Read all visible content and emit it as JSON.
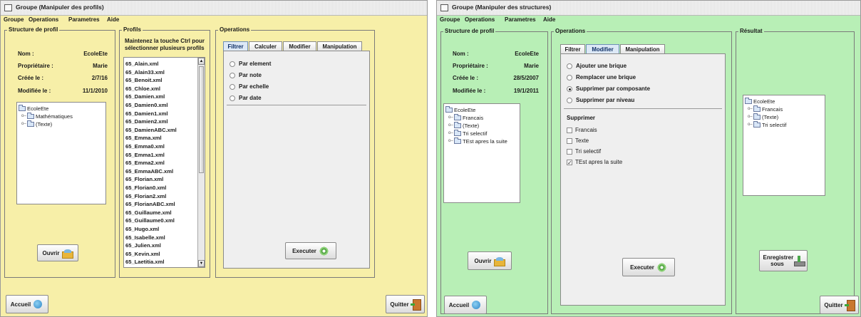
{
  "window1": {
    "title": "Groupe (Manipuler des profils)",
    "menu": [
      "Groupe",
      "Operations",
      "Parametres",
      "Aide"
    ],
    "structure_panel": {
      "legend": "Structure de profil",
      "fields": [
        {
          "label": "Nom :",
          "value": "EcoleEte"
        },
        {
          "label": "Propriétaire :",
          "value": "Marie"
        },
        {
          "label": "Créée le :",
          "value": "2/7/16"
        },
        {
          "label": "Modifiée le :",
          "value": "11/1/2010"
        }
      ],
      "tree": {
        "root": "EcoleEte",
        "children": [
          "Mathématiques",
          "(Texte)"
        ]
      },
      "open_button": "Ouvrir"
    },
    "profils_panel": {
      "legend": "Profils",
      "hint": [
        "Maintenez la touche Ctrl pour",
        "sélectionner plusieurs profils"
      ],
      "files": [
        "65_Alain.xml",
        "65_Alain33.xml",
        "65_Benoit.xml",
        "65_Chloe.xml",
        "65_Damien.xml",
        "65_Damien0.xml",
        "65_Damien1.xml",
        "65_Damien2.xml",
        "65_DamienABC.xml",
        "65_Emma.xml",
        "65_Emma0.xml",
        "65_Emma1.xml",
        "65_Emma2.xml",
        "65_EmmaABC.xml",
        "65_Florian.xml",
        "65_Florian0.xml",
        "65_Florian2.xml",
        "65_FlorianABC.xml",
        "65_Guillaume.xml",
        "65_Guillaume0.xml",
        "65_Hugo.xml",
        "65_Isabelle.xml",
        "65_Julien.xml",
        "65_Kevin.xml",
        "65_Laetitia.xml"
      ]
    },
    "operations_panel": {
      "legend": "Operations",
      "tabs": [
        "Filtrer",
        "Calculer",
        "Modifier",
        "Manipulation"
      ],
      "active_tab": "Filtrer",
      "radios": [
        "Par element",
        "Par note",
        "Par echelle",
        "Par date"
      ],
      "execute_button": "Executer"
    },
    "home_button": "Accueil",
    "quit_button": "Quitter"
  },
  "window2": {
    "title": "Groupe (Manipuler des structures)",
    "menu": [
      "Groupe",
      "Operations",
      "Parametres",
      "Aide"
    ],
    "structure_panel": {
      "legend": "Structure de profil",
      "fields": [
        {
          "label": "Nom :",
          "value": "EcoleEte"
        },
        {
          "label": "Propriétaire :",
          "value": "Marie"
        },
        {
          "label": "Créée le :",
          "value": "28/5/2007"
        },
        {
          "label": "Modifiée le :",
          "value": "19/1/2011"
        }
      ],
      "tree": {
        "root": "EcoleEte",
        "children": [
          "Francais",
          "(Texte)",
          "Tri selectif",
          "TEst apres la suite"
        ]
      },
      "open_button": "Ouvrir"
    },
    "operations_panel": {
      "legend": "Operations",
      "tabs": [
        "Filtrer",
        "Modifier",
        "Manipulation"
      ],
      "active_tab": "Modifier",
      "radios": [
        {
          "label": "Ajouter une brique",
          "selected": false
        },
        {
          "label": "Remplacer une brique",
          "selected": false
        },
        {
          "label": "Supprimer par composante",
          "selected": true
        },
        {
          "label": "Supprimer par niveau",
          "selected": false
        }
      ],
      "delete_heading": "Supprimer",
      "checkboxes": [
        {
          "label": "Francais",
          "checked": false
        },
        {
          "label": "Texte",
          "checked": false
        },
        {
          "label": "Tri selectif",
          "checked": false
        },
        {
          "label": "TEst apres la suite",
          "checked": true
        }
      ],
      "execute_button": "Executer"
    },
    "result_panel": {
      "legend": "Résultat",
      "tree": {
        "root": "EcoleEte",
        "children": [
          "Francais",
          "(Texte)",
          "Tri selectif"
        ]
      },
      "save_button": "Enregistrer sous"
    },
    "home_button": "Accueil",
    "quit_button": "Quitter"
  }
}
